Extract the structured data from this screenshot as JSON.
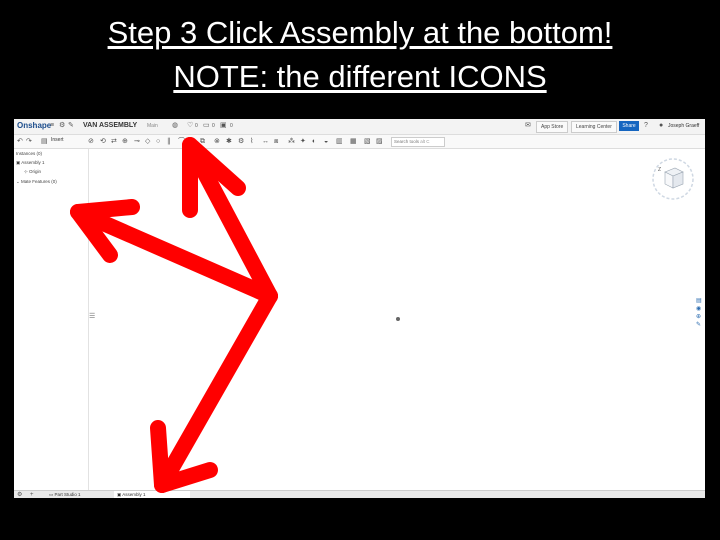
{
  "slide": {
    "title_line1": "Step 3 Click Assembly at the bottom!",
    "title_line2": "NOTE: the different ICONS"
  },
  "app": {
    "logo": "Onshape",
    "document_title": "VAN ASSEMBLY",
    "branch": "Main",
    "counter1": "0",
    "counter2": "0",
    "counter3": "0",
    "app_store": "App Store",
    "learning_center": "Learning Center",
    "share": "Share",
    "user": "Joseph Graeff"
  },
  "toolbar": {
    "insert": "Insert",
    "search_placeholder": "Search tools",
    "search_shortcut": "alt C"
  },
  "feature_panel": {
    "header": "Instances (0)",
    "assembly": "Assembly 1",
    "origin": "Origin",
    "mate_features": "Mate Features (0)"
  },
  "tabs": {
    "part_studio": "Part Studio 1",
    "assembly": "Assembly 1"
  },
  "colors": {
    "arrow": "#ff0000",
    "share_button": "#1565c0",
    "logo": "#1c4d8c"
  }
}
